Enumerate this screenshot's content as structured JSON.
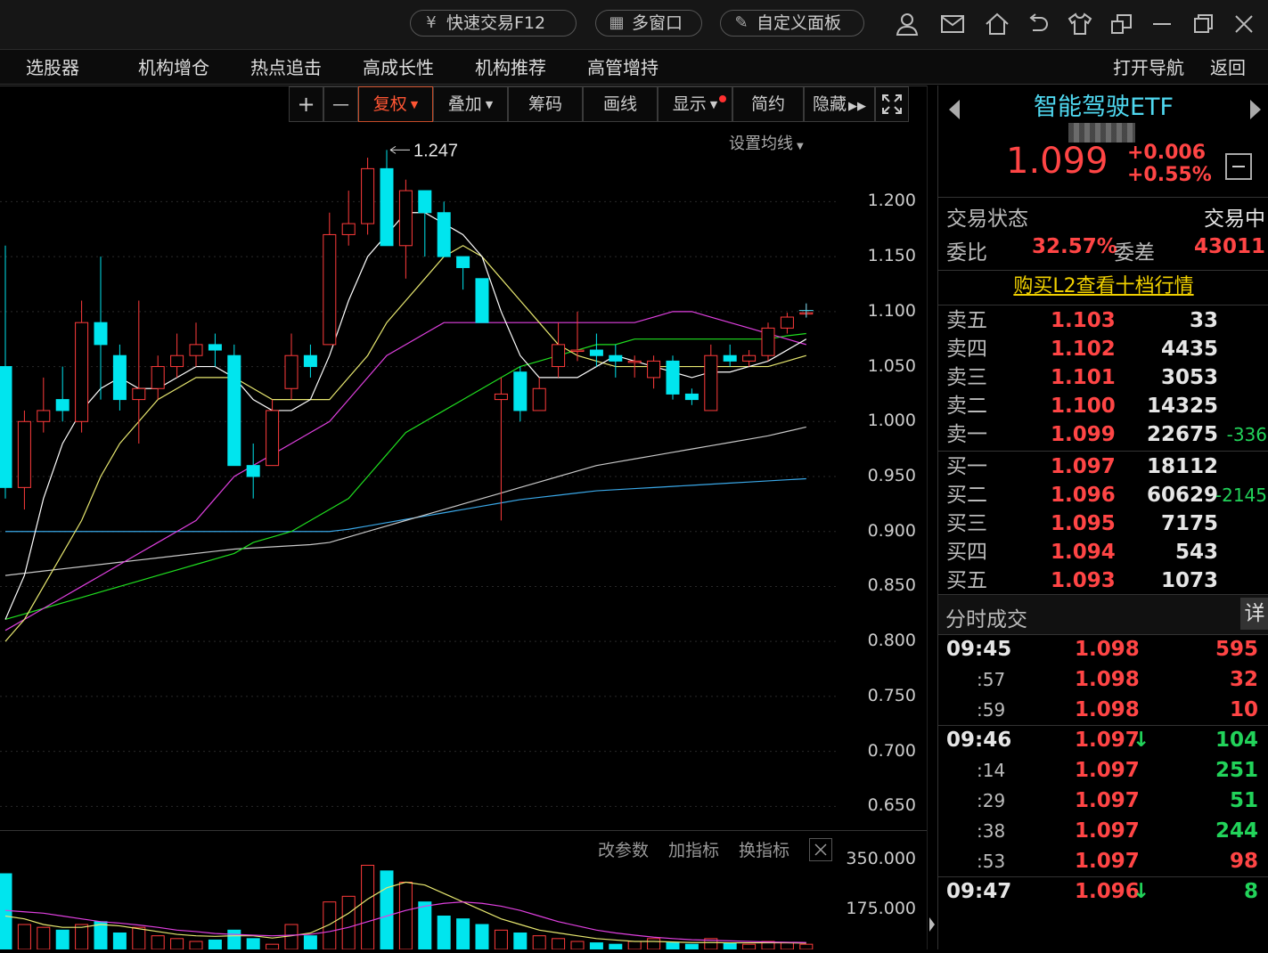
{
  "titlebar": {
    "buttons": [
      {
        "label": "快速交易F12",
        "icon": "yen-circle-icon"
      },
      {
        "label": "多窗口",
        "icon": "grid-icon"
      },
      {
        "label": "自定义面板",
        "icon": "edit-panel-icon"
      }
    ],
    "icons": [
      "user-icon",
      "mail-icon",
      "home-icon",
      "undo-icon",
      "shirt-icon",
      "restore-window-icon",
      "minimize-icon",
      "maximize-icon",
      "close-icon"
    ]
  },
  "menu": {
    "left": [
      "选股器",
      "机构增仓",
      "热点追击",
      "高成长性",
      "机构推荐",
      "高管增持"
    ],
    "right": [
      "打开导航",
      "返回"
    ]
  },
  "toolbar": {
    "plus": "+",
    "minus": "—",
    "fuquan": "复权",
    "diejia": "叠加",
    "chouma": "筹码",
    "huaxian": "画线",
    "xianshi": "显示",
    "jianyue": "简约",
    "yincang": "隐藏",
    "set_ma": "设置均线"
  },
  "chart": {
    "high_label": "1.247",
    "y_axis": [
      "1.200",
      "1.150",
      "1.100",
      "1.050",
      "1.000",
      "0.950",
      "0.900",
      "0.850",
      "0.800",
      "0.750",
      "0.700",
      "0.650"
    ],
    "indicator_links": [
      "改参数",
      "加指标",
      "换指标"
    ],
    "vol_axis": [
      "350.000",
      "175.000"
    ],
    "colors": {
      "up": "#ff3b3b",
      "down": "#00e5ee",
      "ma5": "#ffffff",
      "ma10": "#e8e870",
      "ma20": "#e040e0",
      "ma30": "#20e020",
      "ma60": "#c8c8c8",
      "ma120": "#3aa8e8"
    }
  },
  "chart_data": {
    "type": "candlestick",
    "ylim": [
      0.63,
      1.27
    ],
    "high_marker": 1.247,
    "candles": [
      {
        "o": 1.05,
        "c": 0.94,
        "h": 1.16,
        "l": 0.93
      },
      {
        "o": 0.94,
        "c": 1.0,
        "h": 1.01,
        "l": 0.92
      },
      {
        "o": 1.0,
        "c": 1.01,
        "h": 1.04,
        "l": 0.99
      },
      {
        "o": 1.02,
        "c": 1.01,
        "h": 1.05,
        "l": 1.0
      },
      {
        "o": 1.0,
        "c": 1.09,
        "h": 1.11,
        "l": 0.99
      },
      {
        "o": 1.09,
        "c": 1.07,
        "h": 1.15,
        "l": 1.02
      },
      {
        "o": 1.06,
        "c": 1.02,
        "h": 1.07,
        "l": 1.01
      },
      {
        "o": 1.02,
        "c": 1.03,
        "h": 1.11,
        "l": 0.98
      },
      {
        "o": 1.03,
        "c": 1.05,
        "h": 1.06,
        "l": 1.02
      },
      {
        "o": 1.05,
        "c": 1.06,
        "h": 1.08,
        "l": 1.04
      },
      {
        "o": 1.06,
        "c": 1.07,
        "h": 1.09,
        "l": 1.05
      },
      {
        "o": 1.07,
        "c": 1.065,
        "h": 1.08,
        "l": 1.05
      },
      {
        "o": 1.06,
        "c": 0.96,
        "h": 1.07,
        "l": 0.96
      },
      {
        "o": 0.96,
        "c": 0.95,
        "h": 0.98,
        "l": 0.93
      },
      {
        "o": 0.96,
        "c": 1.01,
        "h": 1.02,
        "l": 0.96
      },
      {
        "o": 1.03,
        "c": 1.06,
        "h": 1.08,
        "l": 1.02
      },
      {
        "o": 1.06,
        "c": 1.05,
        "h": 1.07,
        "l": 1.04
      },
      {
        "o": 1.07,
        "c": 1.17,
        "h": 1.19,
        "l": 1.07
      },
      {
        "o": 1.17,
        "c": 1.18,
        "h": 1.21,
        "l": 1.16
      },
      {
        "o": 1.18,
        "c": 1.23,
        "h": 1.24,
        "l": 1.17
      },
      {
        "o": 1.23,
        "c": 1.16,
        "h": 1.247,
        "l": 1.16
      },
      {
        "o": 1.16,
        "c": 1.21,
        "h": 1.22,
        "l": 1.13
      },
      {
        "o": 1.21,
        "c": 1.19,
        "h": 1.21,
        "l": 1.15
      },
      {
        "o": 1.19,
        "c": 1.15,
        "h": 1.2,
        "l": 1.15
      },
      {
        "o": 1.15,
        "c": 1.14,
        "h": 1.15,
        "l": 1.12
      },
      {
        "o": 1.13,
        "c": 1.09,
        "h": 1.13,
        "l": 1.09
      },
      {
        "o": 1.02,
        "c": 1.025,
        "h": 1.04,
        "l": 0.91
      },
      {
        "o": 1.045,
        "c": 1.01,
        "h": 1.05,
        "l": 1.0
      },
      {
        "o": 1.01,
        "c": 1.03,
        "h": 1.04,
        "l": 1.01
      },
      {
        "o": 1.05,
        "c": 1.07,
        "h": 1.09,
        "l": 1.04
      },
      {
        "o": 1.065,
        "c": 1.065,
        "h": 1.1,
        "l": 1.055
      },
      {
        "o": 1.065,
        "c": 1.06,
        "h": 1.08,
        "l": 1.05
      },
      {
        "o": 1.06,
        "c": 1.055,
        "h": 1.07,
        "l": 1.04
      },
      {
        "o": 1.055,
        "c": 1.055,
        "h": 1.06,
        "l": 1.04
      },
      {
        "o": 1.04,
        "c": 1.055,
        "h": 1.06,
        "l": 1.03
      },
      {
        "o": 1.055,
        "c": 1.025,
        "h": 1.06,
        "l": 1.02
      },
      {
        "o": 1.025,
        "c": 1.02,
        "h": 1.03,
        "l": 1.015
      },
      {
        "o": 1.01,
        "c": 1.06,
        "h": 1.07,
        "l": 1.01
      },
      {
        "o": 1.06,
        "c": 1.055,
        "h": 1.07,
        "l": 1.05
      },
      {
        "o": 1.055,
        "c": 1.06,
        "h": 1.065,
        "l": 1.05
      },
      {
        "o": 1.06,
        "c": 1.085,
        "h": 1.09,
        "l": 1.055
      },
      {
        "o": 1.085,
        "c": 1.095,
        "h": 1.099,
        "l": 1.08
      },
      {
        "o": 1.099,
        "c": 1.099,
        "h": 1.107,
        "l": 1.095
      }
    ],
    "ma5": [
      0.82,
      0.86,
      0.93,
      0.98,
      1.01,
      1.03,
      1.04,
      1.03,
      1.03,
      1.04,
      1.05,
      1.05,
      1.04,
      1.02,
      1.01,
      1.01,
      1.02,
      1.06,
      1.11,
      1.15,
      1.17,
      1.19,
      1.19,
      1.18,
      1.17,
      1.15,
      1.1,
      1.06,
      1.04,
      1.04,
      1.04,
      1.05,
      1.06,
      1.055,
      1.05,
      1.045,
      1.04,
      1.045,
      1.045,
      1.05,
      1.055,
      1.065,
      1.075
    ],
    "ma10": [
      0.8,
      0.82,
      0.85,
      0.88,
      0.91,
      0.95,
      0.98,
      1.0,
      1.02,
      1.03,
      1.04,
      1.04,
      1.04,
      1.03,
      1.02,
      1.02,
      1.02,
      1.02,
      1.04,
      1.06,
      1.09,
      1.11,
      1.13,
      1.15,
      1.16,
      1.15,
      1.13,
      1.11,
      1.09,
      1.07,
      1.06,
      1.055,
      1.05,
      1.05,
      1.05,
      1.05,
      1.05,
      1.05,
      1.05,
      1.05,
      1.05,
      1.055,
      1.06
    ],
    "ma20": [
      0.81,
      0.82,
      0.83,
      0.84,
      0.85,
      0.86,
      0.87,
      0.88,
      0.89,
      0.9,
      0.91,
      0.93,
      0.95,
      0.96,
      0.97,
      0.98,
      0.99,
      1.0,
      1.02,
      1.04,
      1.06,
      1.07,
      1.08,
      1.09,
      1.09,
      1.09,
      1.09,
      1.09,
      1.09,
      1.09,
      1.09,
      1.09,
      1.09,
      1.09,
      1.095,
      1.1,
      1.1,
      1.095,
      1.09,
      1.085,
      1.08,
      1.075,
      1.07
    ],
    "ma30": [
      0.82,
      0.825,
      0.83,
      0.835,
      0.84,
      0.845,
      0.85,
      0.855,
      0.86,
      0.865,
      0.87,
      0.875,
      0.88,
      0.89,
      0.895,
      0.9,
      0.91,
      0.92,
      0.93,
      0.95,
      0.97,
      0.99,
      1.0,
      1.01,
      1.02,
      1.03,
      1.04,
      1.05,
      1.055,
      1.06,
      1.065,
      1.07,
      1.07,
      1.075,
      1.075,
      1.075,
      1.075,
      1.075,
      1.075,
      1.075,
      1.075,
      1.078,
      1.08
    ],
    "ma60": [
      0.86,
      0.862,
      0.864,
      0.866,
      0.868,
      0.87,
      0.872,
      0.874,
      0.876,
      0.878,
      0.88,
      0.882,
      0.884,
      0.885,
      0.886,
      0.887,
      0.888,
      0.89,
      0.895,
      0.9,
      0.905,
      0.91,
      0.915,
      0.92,
      0.925,
      0.93,
      0.935,
      0.94,
      0.945,
      0.95,
      0.955,
      0.96,
      0.963,
      0.966,
      0.969,
      0.972,
      0.975,
      0.978,
      0.981,
      0.984,
      0.987,
      0.991,
      0.995
    ],
    "ma120": [
      0.9,
      0.9,
      0.9,
      0.9,
      0.9,
      0.9,
      0.9,
      0.9,
      0.9,
      0.9,
      0.9,
      0.9,
      0.9,
      0.9,
      0.9,
      0.9,
      0.9,
      0.9,
      0.902,
      0.905,
      0.908,
      0.911,
      0.914,
      0.917,
      0.92,
      0.923,
      0.926,
      0.929,
      0.931,
      0.933,
      0.935,
      0.937,
      0.938,
      0.939,
      0.94,
      0.941,
      0.942,
      0.943,
      0.944,
      0.945,
      0.946,
      0.947,
      0.948
    ],
    "volume": {
      "ylim": [
        0,
        420
      ],
      "ticks": [
        350,
        175
      ],
      "values": [
        300,
        120,
        110,
        100,
        120,
        130,
        90,
        110,
        80,
        70,
        60,
        65,
        100,
        70,
        50,
        120,
        80,
        200,
        220,
        330,
        310,
        270,
        200,
        150,
        140,
        120,
        100,
        90,
        80,
        70,
        60,
        55,
        50,
        60,
        70,
        55,
        50,
        70,
        55,
        50,
        60,
        55,
        50
      ],
      "ma5": [
        150,
        140,
        120,
        110,
        110,
        120,
        115,
        105,
        95,
        85,
        80,
        78,
        80,
        80,
        72,
        80,
        90,
        120,
        160,
        210,
        250,
        270,
        260,
        230,
        200,
        170,
        140,
        120,
        100,
        90,
        80,
        70,
        65,
        60,
        60,
        58,
        56,
        56,
        55,
        55,
        55,
        55,
        54
      ],
      "ma10": [
        170,
        165,
        160,
        150,
        140,
        130,
        125,
        118,
        110,
        100,
        95,
        88,
        85,
        82,
        80,
        82,
        85,
        95,
        110,
        130,
        150,
        170,
        185,
        195,
        200,
        195,
        185,
        170,
        150,
        130,
        115,
        100,
        90,
        82,
        75,
        70,
        66,
        64,
        62,
        60,
        58,
        57,
        56
      ]
    }
  },
  "quote": {
    "name": "智能驾驶ETF",
    "price": "1.099",
    "change": "+0.006",
    "change_pct": "+0.55%",
    "status_label": "交易状态",
    "status_value": "交易中",
    "weibi_label": "委比",
    "weibi_value": "32.57%",
    "weicha_label": "委差",
    "weicha_value": "43011",
    "l2_link": "购买L2查看十档行情",
    "asks": [
      {
        "label": "卖五",
        "price": "1.103",
        "vol": "33",
        "delta": ""
      },
      {
        "label": "卖四",
        "price": "1.102",
        "vol": "4435",
        "delta": ""
      },
      {
        "label": "卖三",
        "price": "1.101",
        "vol": "3053",
        "delta": ""
      },
      {
        "label": "卖二",
        "price": "1.100",
        "vol": "14325",
        "delta": ""
      },
      {
        "label": "卖一",
        "price": "1.099",
        "vol": "22675",
        "delta": "-336"
      }
    ],
    "bids": [
      {
        "label": "买一",
        "price": "1.097",
        "vol": "18112",
        "delta": ""
      },
      {
        "label": "买二",
        "price": "1.096",
        "vol": "60629",
        "delta": "-2145"
      },
      {
        "label": "买三",
        "price": "1.095",
        "vol": "7175",
        "delta": ""
      },
      {
        "label": "买四",
        "price": "1.094",
        "vol": "543",
        "delta": ""
      },
      {
        "label": "买五",
        "price": "1.093",
        "vol": "1073",
        "delta": ""
      }
    ],
    "ticks_title": "分时成交",
    "ticks_detail": "详",
    "ticks": [
      {
        "time": "09:45",
        "major": true,
        "price": "1.098",
        "vol": "595",
        "dir": "up",
        "arrow": ""
      },
      {
        "time": ":57",
        "major": false,
        "price": "1.098",
        "vol": "32",
        "dir": "up",
        "arrow": ""
      },
      {
        "time": ":59",
        "major": false,
        "price": "1.098",
        "vol": "10",
        "dir": "up",
        "arrow": ""
      },
      {
        "time": "09:46",
        "major": true,
        "price": "1.097",
        "vol": "104",
        "dir": "down",
        "arrow": "↓"
      },
      {
        "time": ":14",
        "major": false,
        "price": "1.097",
        "vol": "251",
        "dir": "down",
        "arrow": ""
      },
      {
        "time": ":29",
        "major": false,
        "price": "1.097",
        "vol": "51",
        "dir": "down",
        "arrow": ""
      },
      {
        "time": ":38",
        "major": false,
        "price": "1.097",
        "vol": "244",
        "dir": "down",
        "arrow": ""
      },
      {
        "time": ":53",
        "major": false,
        "price": "1.097",
        "vol": "98",
        "dir": "up",
        "arrow": ""
      },
      {
        "time": "09:47",
        "major": true,
        "price": "1.096",
        "vol": "8",
        "dir": "down",
        "arrow": "↓"
      }
    ]
  }
}
